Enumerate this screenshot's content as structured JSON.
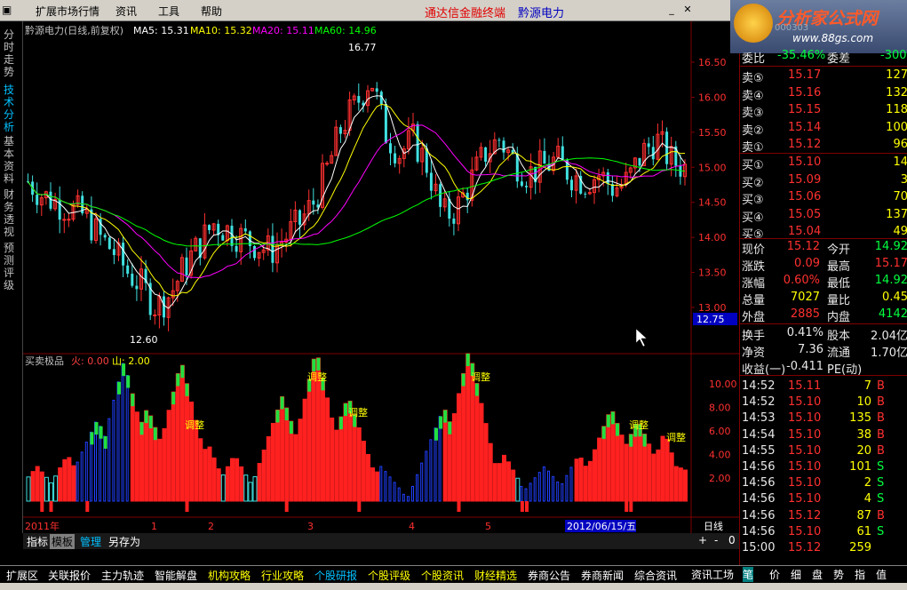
{
  "menu": {
    "items": [
      "扩展市场行情",
      "资讯",
      "工具",
      "帮助"
    ],
    "title_left": "通达信金融终端",
    "title_right": "黔源电力"
  },
  "logo": {
    "text": "分析家公式网",
    "url_text": "www.88gs.com",
    "code_text": "000303"
  },
  "left_tabs": [
    "分时走势",
    "技术分析",
    "基本资料",
    "财务透视",
    "预测评级"
  ],
  "main_chart": {
    "title": "黔源电力(日线,前复权)",
    "ma": [
      {
        "label": "MA5: 15.31",
        "color": "#ffffff"
      },
      {
        "label": "MA10: 15.32",
        "color": "#ffff00"
      },
      {
        "label": "MA20: 15.11",
        "color": "#ff00ff"
      },
      {
        "label": "MA60: 14.96",
        "color": "#00ff00"
      }
    ],
    "yticks": [
      "16.50",
      "16.00",
      "15.50",
      "15.00",
      "14.50",
      "14.00",
      "13.50",
      "13.00"
    ],
    "high_label": "16.77",
    "low_label": "12.60",
    "price_box": "12.75"
  },
  "sub_chart": {
    "title": "买卖极品",
    "fire": "火: 0.00",
    "mountain": "山: 2.00",
    "yticks": [
      "10.00",
      "8.00",
      "6.00",
      "4.00",
      "2.00"
    ],
    "signal": "调整"
  },
  "xaxis": {
    "labels": [
      "2011年",
      "1",
      "2",
      "3",
      "4",
      "5"
    ],
    "date_box": "2012/06/15/五",
    "period": "日线"
  },
  "bottom_tabs": {
    "items": [
      "指标",
      "模板",
      "管理",
      "另存为"
    ],
    "zoom": [
      "+",
      "-",
      "0"
    ]
  },
  "quote": {
    "weibi": {
      "label": "委比",
      "value": "-35.46%",
      "label2": "委差",
      "value2": "-300"
    },
    "sells": [
      {
        "label": "卖⑤",
        "price": "15.17",
        "vol": "127"
      },
      {
        "label": "卖④",
        "price": "15.16",
        "vol": "132"
      },
      {
        "label": "卖③",
        "price": "15.15",
        "vol": "118"
      },
      {
        "label": "卖②",
        "price": "15.14",
        "vol": "100"
      },
      {
        "label": "卖①",
        "price": "15.12",
        "vol": "96"
      }
    ],
    "buys": [
      {
        "label": "买①",
        "price": "15.10",
        "vol": "14"
      },
      {
        "label": "买②",
        "price": "15.09",
        "vol": "3"
      },
      {
        "label": "买③",
        "price": "15.06",
        "vol": "70"
      },
      {
        "label": "买④",
        "price": "15.05",
        "vol": "137"
      },
      {
        "label": "买⑤",
        "price": "15.04",
        "vol": "49"
      }
    ],
    "stats": [
      {
        "l1": "现价",
        "v1": "15.12",
        "l2": "今开",
        "v2": "14.92"
      },
      {
        "l1": "涨跌",
        "v1": "0.09",
        "l2": "最高",
        "v2": "15.17"
      },
      {
        "l1": "涨幅",
        "v1": "0.60%",
        "l2": "最低",
        "v2": "14.92"
      },
      {
        "l1": "总量",
        "v1": "7027",
        "l2": "量比",
        "v2": "0.45"
      },
      {
        "l1": "外盘",
        "v1": "2885",
        "l2": "内盘",
        "v2": "4142"
      }
    ],
    "stats2": [
      {
        "l1": "换手",
        "v1": "0.41%",
        "l2": "股本",
        "v2": "2.04亿"
      },
      {
        "l1": "净资",
        "v1": "7.36",
        "l2": "流通",
        "v2": "1.70亿"
      },
      {
        "l1": "收益(一)",
        "v1": "-0.411",
        "l2": "PE(动)",
        "v2": ""
      }
    ],
    "ticks": [
      {
        "t": "14:52",
        "p": "15.11",
        "v": "7",
        "d": "B"
      },
      {
        "t": "14:52",
        "p": "15.10",
        "v": "10",
        "d": "B"
      },
      {
        "t": "14:53",
        "p": "15.10",
        "v": "135",
        "d": "B"
      },
      {
        "t": "14:54",
        "p": "15.10",
        "v": "38",
        "d": "B"
      },
      {
        "t": "14:55",
        "p": "15.10",
        "v": "20",
        "d": "B"
      },
      {
        "t": "14:56",
        "p": "15.10",
        "v": "101",
        "d": "S"
      },
      {
        "t": "14:56",
        "p": "15.10",
        "v": "2",
        "d": "S"
      },
      {
        "t": "14:56",
        "p": "15.10",
        "v": "4",
        "d": "S"
      },
      {
        "t": "14:56",
        "p": "15.12",
        "v": "87",
        "d": "B"
      },
      {
        "t": "14:56",
        "p": "15.10",
        "v": "61",
        "d": "S"
      },
      {
        "t": "15:00",
        "p": "15.12",
        "v": "259",
        "d": ""
      }
    ]
  },
  "status_tabs": [
    "扩展区",
    "关联报价",
    "主力轨迹",
    "智能解盘",
    "机构攻略",
    "行业攻略",
    "个股研报",
    "个股评级",
    "个股资讯",
    "财经精选",
    "券商公告",
    "券商新闻",
    "综合资讯"
  ],
  "right_buttons": [
    "资讯工场",
    "笔",
    "价",
    "细",
    "盘",
    "势",
    "指",
    "值"
  ]
}
